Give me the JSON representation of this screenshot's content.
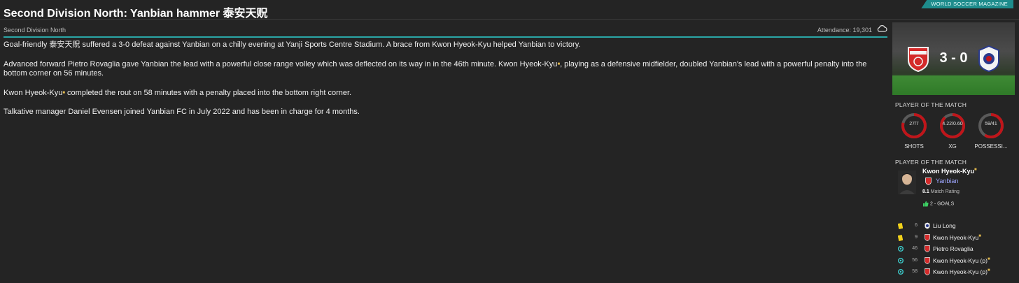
{
  "headline": "Second Division North: Yanbian hammer 泰安天贶",
  "badge": "WORLD SOCCER MAGAZINE",
  "meta": {
    "league": "Second Division North",
    "attendance": "Attendance: 19,301",
    "weather_icon": "cloud-icon"
  },
  "article": {
    "p1": "Goal-friendly 泰安天贶 suffered a 3-0 defeat against Yanbian on a chilly evening at Yanji Sports Centre Stadium. A brace from Kwon Hyeok-Kyu helped Yanbian to victory.",
    "p2_a": "Advanced forward Pietro Rovaglia gave Yanbian the lead with a powerful close range volley which was deflected on its way in in the 46th minute. Kwon Hyeok-Kyu",
    "p2_b": ", playing as a defensive midfielder, doubled Yanbian's lead with a powerful penalty into the bottom corner on 56 minutes.",
    "p3_a": "Kwon Hyeok-Kyu",
    "p3_b": " completed the rout on 58 minutes with a penalty placed into the bottom right corner.",
    "p4": "Talkative manager Daniel Evensen joined Yanbian FC in July 2022 and has been in charge for 4 months."
  },
  "score": "3 - 0",
  "stats_label": "PLAYER OF THE MATCH",
  "stats": [
    {
      "value": "27/7",
      "label": "SHOTS",
      "fraction": 0.79
    },
    {
      "value": "4.22/0.60",
      "label": "XG",
      "fraction": 0.88
    },
    {
      "value": "59/41",
      "label": "POSSESSI...",
      "fraction": 0.59
    }
  ],
  "potm_label": "PLAYER OF THE MATCH",
  "potm": {
    "name": "Kwon Hyeok-Kyu",
    "club": "Yanbian",
    "rating_value": "8.1",
    "rating_label": "Match Rating",
    "goals": "2 - GOALS"
  },
  "events": [
    {
      "type": "yellow-card",
      "minute": "6",
      "player": "Liu Long",
      "team": "away"
    },
    {
      "type": "yellow-card",
      "minute": "9",
      "player": "Kwon Hyeok-Kyu",
      "team": "home",
      "star": true
    },
    {
      "type": "goal",
      "minute": "46",
      "player": "Pietro Rovaglia",
      "team": "home"
    },
    {
      "type": "goal",
      "minute": "56",
      "player": "Kwon Hyeok-Kyu (p)",
      "team": "home",
      "star": true
    },
    {
      "type": "goal",
      "minute": "58",
      "player": "Kwon Hyeok-Kyu (p)",
      "team": "home",
      "star": true
    }
  ],
  "colors": {
    "accent": "#2aa7a7",
    "ring": "#c0151a",
    "yellow_card": "#f2d21b",
    "goal_icon": "#3cc9c9"
  }
}
